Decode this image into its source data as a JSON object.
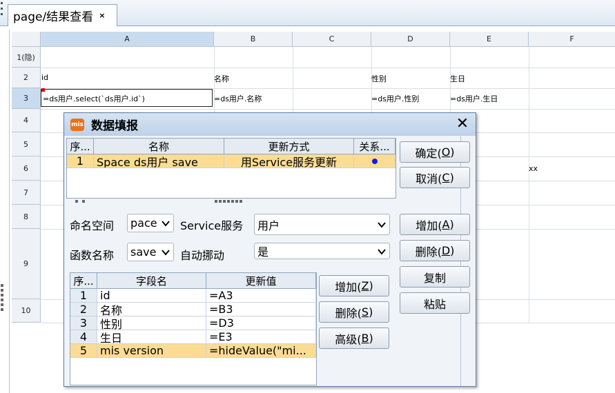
{
  "editor_tab": {
    "title": "page/结果查看",
    "close": "×"
  },
  "sheet": {
    "columns": [
      "A",
      "B",
      "C",
      "D",
      "E",
      "F"
    ],
    "rows": [
      "1(隐)",
      "2",
      "3",
      "4",
      "5",
      "6",
      "7",
      "8",
      "9",
      "10"
    ],
    "row2": {
      "a": "id",
      "b": "名称",
      "d": "性别",
      "e": "生日"
    },
    "row3": {
      "a": "=ds用户.select(`ds用户.id`)",
      "b": "=ds用户.名称",
      "d": "=ds用户.性别",
      "e": "=ds用户.生日"
    },
    "row6_e": "xx"
  },
  "dialog": {
    "logo": "mis",
    "title": "数据填报",
    "close": "✕",
    "top_table": {
      "headers": [
        "序...",
        "名称",
        "更新方式",
        "关系..."
      ],
      "rows": [
        {
          "seq": "1",
          "name": "Space ds用户 save",
          "method": "用Service服务更新"
        }
      ]
    },
    "buttons_right": {
      "ok": "确定(",
      "ok_key": "O",
      "cancel": "取消(",
      "cancel_key": "C",
      "add": "增加(",
      "add_key": "A",
      "del": "删除(",
      "del_key": "D",
      "copy": "复制",
      "paste": "粘贴"
    },
    "namespace_label": "命名空间",
    "namespace_value": "pace",
    "service_label": "Service服务",
    "service_value": "用户",
    "func_label": "函数名称",
    "func_value": "save",
    "auto_label": "自动挪动",
    "auto_value": "是",
    "field_table": {
      "headers": [
        "序...",
        "字段名",
        "更新值"
      ],
      "rows": [
        {
          "seq": "1",
          "field": "id",
          "value": "=A3"
        },
        {
          "seq": "2",
          "field": "名称",
          "value": "=B3"
        },
        {
          "seq": "3",
          "field": "性别",
          "value": "=D3"
        },
        {
          "seq": "4",
          "field": "生日",
          "value": "=E3"
        },
        {
          "seq": "5",
          "field": "mis version",
          "value": "=hideValue(\"mi..."
        }
      ]
    },
    "buttons_mid": {
      "add": "增加(",
      "add_key": "Z",
      "del": "删除(",
      "del_key": "S",
      "adv": "高级(",
      "adv_key": "B"
    }
  }
}
